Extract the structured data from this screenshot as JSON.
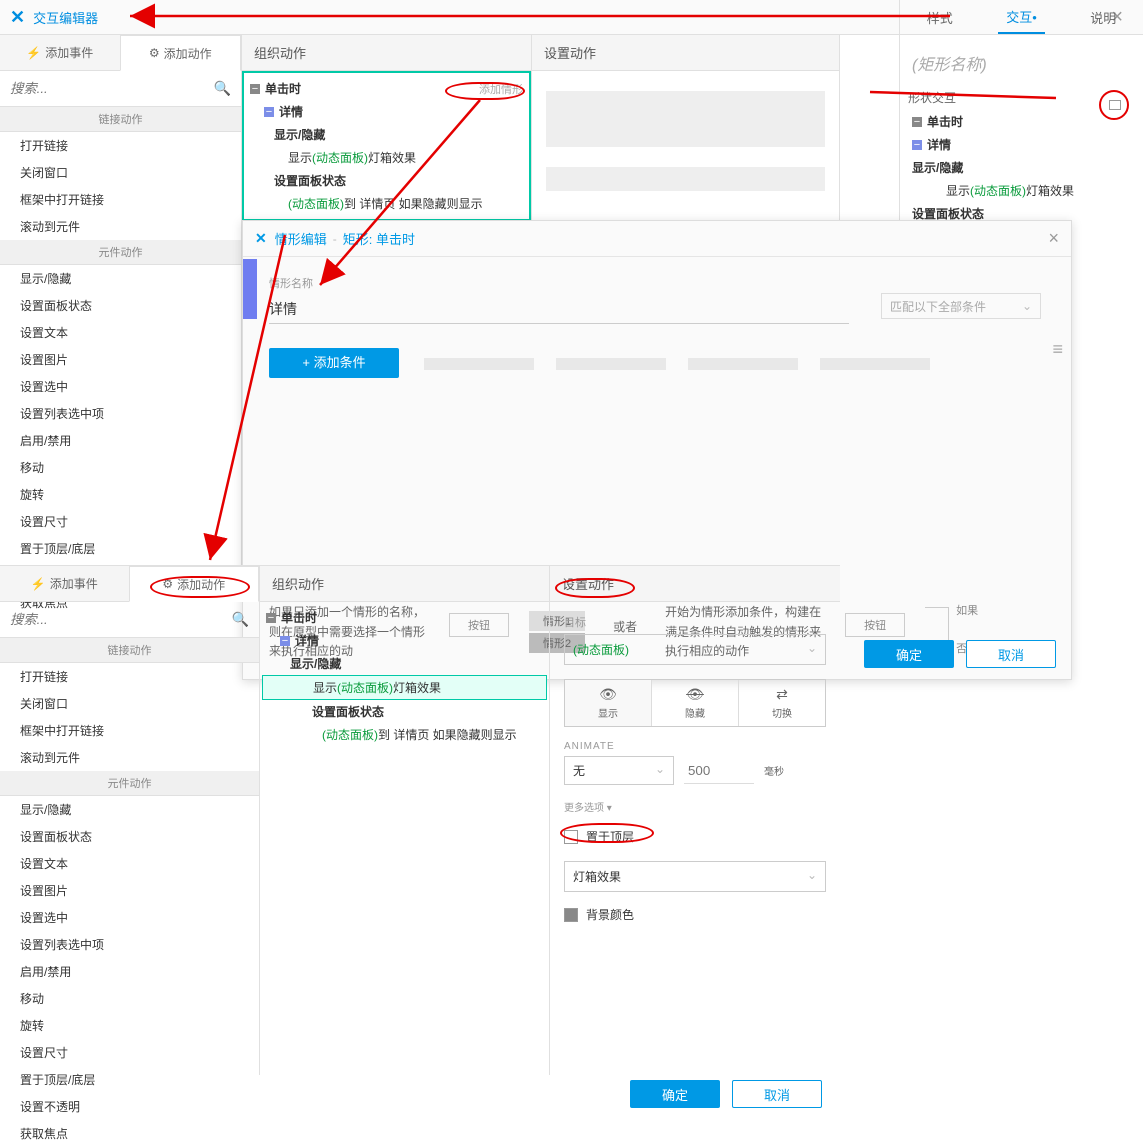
{
  "header": {
    "title": "交互编辑器",
    "close": "×"
  },
  "rightPanel": {
    "tabs": [
      "样式",
      "交互•",
      "说明"
    ],
    "shapeName": "(矩形名称)",
    "shapeInter": "形状交互",
    "tree": {
      "click": "单击时",
      "detail": "详情",
      "showhide": "显示/隐藏",
      "showText": "显示 ",
      "dyn": "(动态面板)",
      "lightbox": " 灯箱效果",
      "setState": "设置面板状态"
    }
  },
  "subTabs": {
    "addEvent": "添加事件",
    "addAction": "添加动作"
  },
  "search": {
    "placeholder": "搜索..."
  },
  "groups": {
    "link": "链接动作",
    "widget": "元件动作"
  },
  "linkActions": [
    "打开链接",
    "关闭窗口",
    "框架中打开链接",
    "滚动到元件"
  ],
  "widgetActions": [
    "显示/隐藏",
    "设置面板状态",
    "设置文本",
    "设置图片",
    "设置选中",
    "设置列表选中项",
    "启用/禁用",
    "移动",
    "旋转",
    "设置尺寸",
    "置于顶层/底层",
    "设置不透明",
    "获取焦点"
  ],
  "midCol": {
    "header": "组织动作",
    "click": "单击时",
    "addCase": "添加情形",
    "detail": "详情",
    "showhide": "显示/隐藏",
    "showText": "显示",
    "dyn": "(动态面板)",
    "lightbox": "灯箱效果",
    "setState": "设置面板状态",
    "stateDesc": "到 详情页 如果隐藏则显示"
  },
  "setCol": {
    "header": "设置动作"
  },
  "modal": {
    "edit": "情形编辑",
    "shape": "矩形: 单击时",
    "close": "×",
    "nameLabel": "情形名称",
    "nameValue": "详情",
    "match": "匹配以下全部条件",
    "addCond": "+ 添加条件",
    "info1": "如果只添加一个情形的名称，则在原型中需要选择一个情形来执行相应的动",
    "btn": "按钮",
    "case1": "情形1",
    "case2": "情形2",
    "or": "或者",
    "info2": "开始为情形添加条件，构建在满足条件时自动触发的情形来执行相应的动作",
    "if": "如果",
    "else": "否则",
    "ok": "确定",
    "cancel": "取消"
  },
  "config": {
    "header": "设置动作",
    "target": "目标",
    "targetVal": "(动态面板)",
    "visTabs": {
      "show": "显示",
      "hide": "隐藏",
      "toggle": "切换"
    },
    "animate": "ANIMATE",
    "animVal": "无",
    "animTime": "500",
    "unit": "毫秒",
    "moreOpt": "更多选项 ▾",
    "onTop": "置于顶层",
    "lightbox": "灯箱效果",
    "bgColor": "背景颜色"
  },
  "btns": {
    "ok": "确定",
    "cancel": "取消"
  }
}
